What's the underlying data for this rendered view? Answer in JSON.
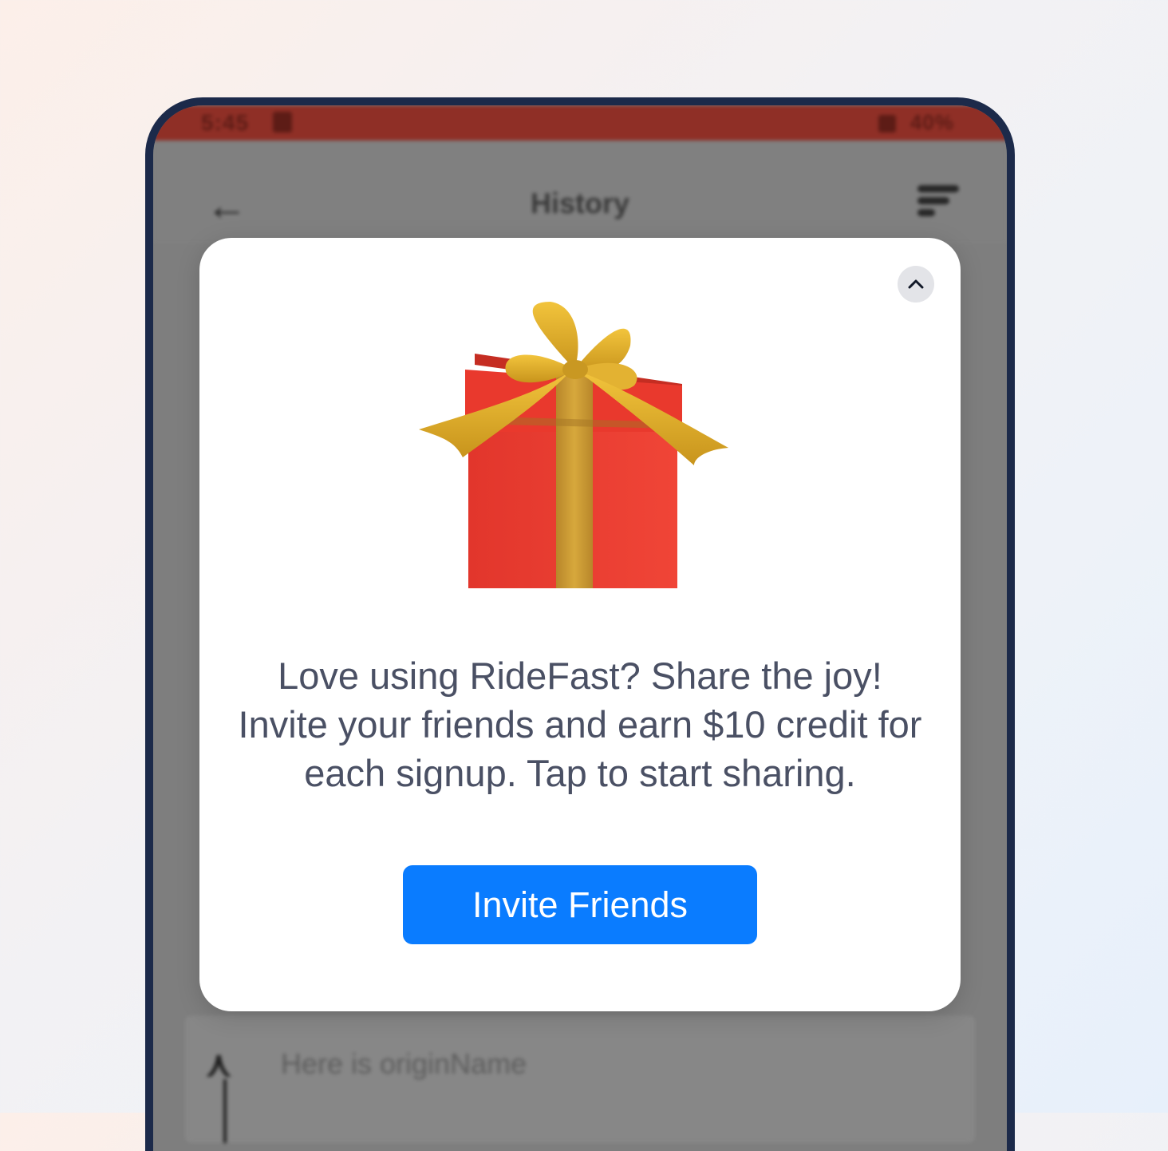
{
  "status_bar": {
    "time": "5:45",
    "right": "40%"
  },
  "app_bar": {
    "back_icon": "arrow-left-icon",
    "title": "History",
    "sort_icon": "sort-icon"
  },
  "background_list": {
    "origin_placeholder": "Here is originName"
  },
  "modal": {
    "collapse_icon": "chevron-up-icon",
    "image": "gift-box",
    "message": "Love using RideFast? Share the joy! Invite your friends and earn $10 credit for each signup. Tap to start sharing.",
    "button_label": "Invite Friends"
  },
  "colors": {
    "status_bar": "#8f2f26",
    "frame": "#1c2a4a",
    "button": "#0a7cff",
    "text": "#4a5064",
    "gift_box": "#e53a2e",
    "ribbon": "#d4a52a"
  }
}
